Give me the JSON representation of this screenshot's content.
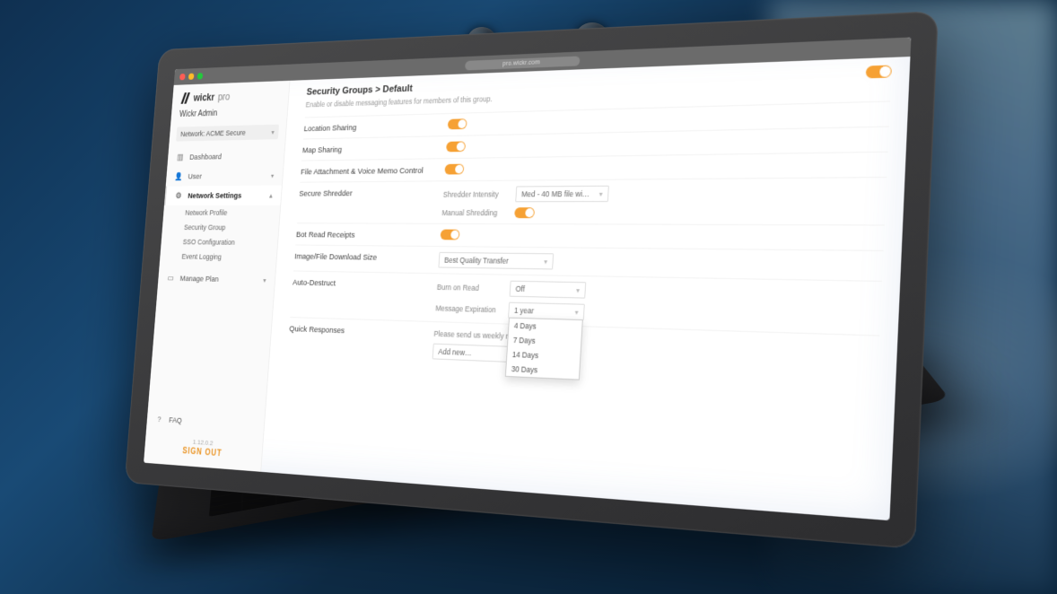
{
  "browser": {
    "url": "pro.wickr.com"
  },
  "brand": {
    "name": "wickr",
    "suffix": "pro"
  },
  "admin_title": "Wickr Admin",
  "network_selector": {
    "label": "Network: ACME Secure"
  },
  "nav": {
    "dashboard": "Dashboard",
    "user": "User",
    "network_settings": "Network Settings",
    "subs": {
      "profile": "Network Profile",
      "security_group": "Security Group",
      "sso": "SSO Configuration",
      "event_logging": "Event Logging"
    },
    "manage_plan": "Manage Plan",
    "faq": "FAQ"
  },
  "footer": {
    "version": "1.12.0.2",
    "signout": "SIGN OUT"
  },
  "breadcrumb": "Security Groups > Default",
  "page_hint": "Enable or disable messaging features for members of this group.",
  "settings": {
    "location_sharing": "Location Sharing",
    "map_sharing": "Map Sharing",
    "file_attach": "File Attachment & Voice Memo Control",
    "secure_shredder": "Secure Shredder",
    "bor": "Bot Read Receipts",
    "image_dl": "Image/File Download Size",
    "auto_destruct": "Auto-Destruct",
    "quick_responses": "Quick Responses"
  },
  "sub": {
    "shredder_intensity": {
      "label": "Shredder Intensity",
      "value": "Med - 40 MB file wi…"
    },
    "manual_shredding": "Manual Shredding",
    "best_quality": {
      "value": "Best Quality Transfer"
    },
    "burn_on_read": {
      "label": "Burn on Read",
      "value": "Off"
    },
    "msg_expiration": {
      "label": "Message Expiration",
      "value": "1 year"
    },
    "please_send": "Please send us weekly reports to",
    "add_new": "Add new…"
  },
  "dd_options": [
    "4 Days",
    "7 Days",
    "14 Days",
    "30 Days"
  ]
}
